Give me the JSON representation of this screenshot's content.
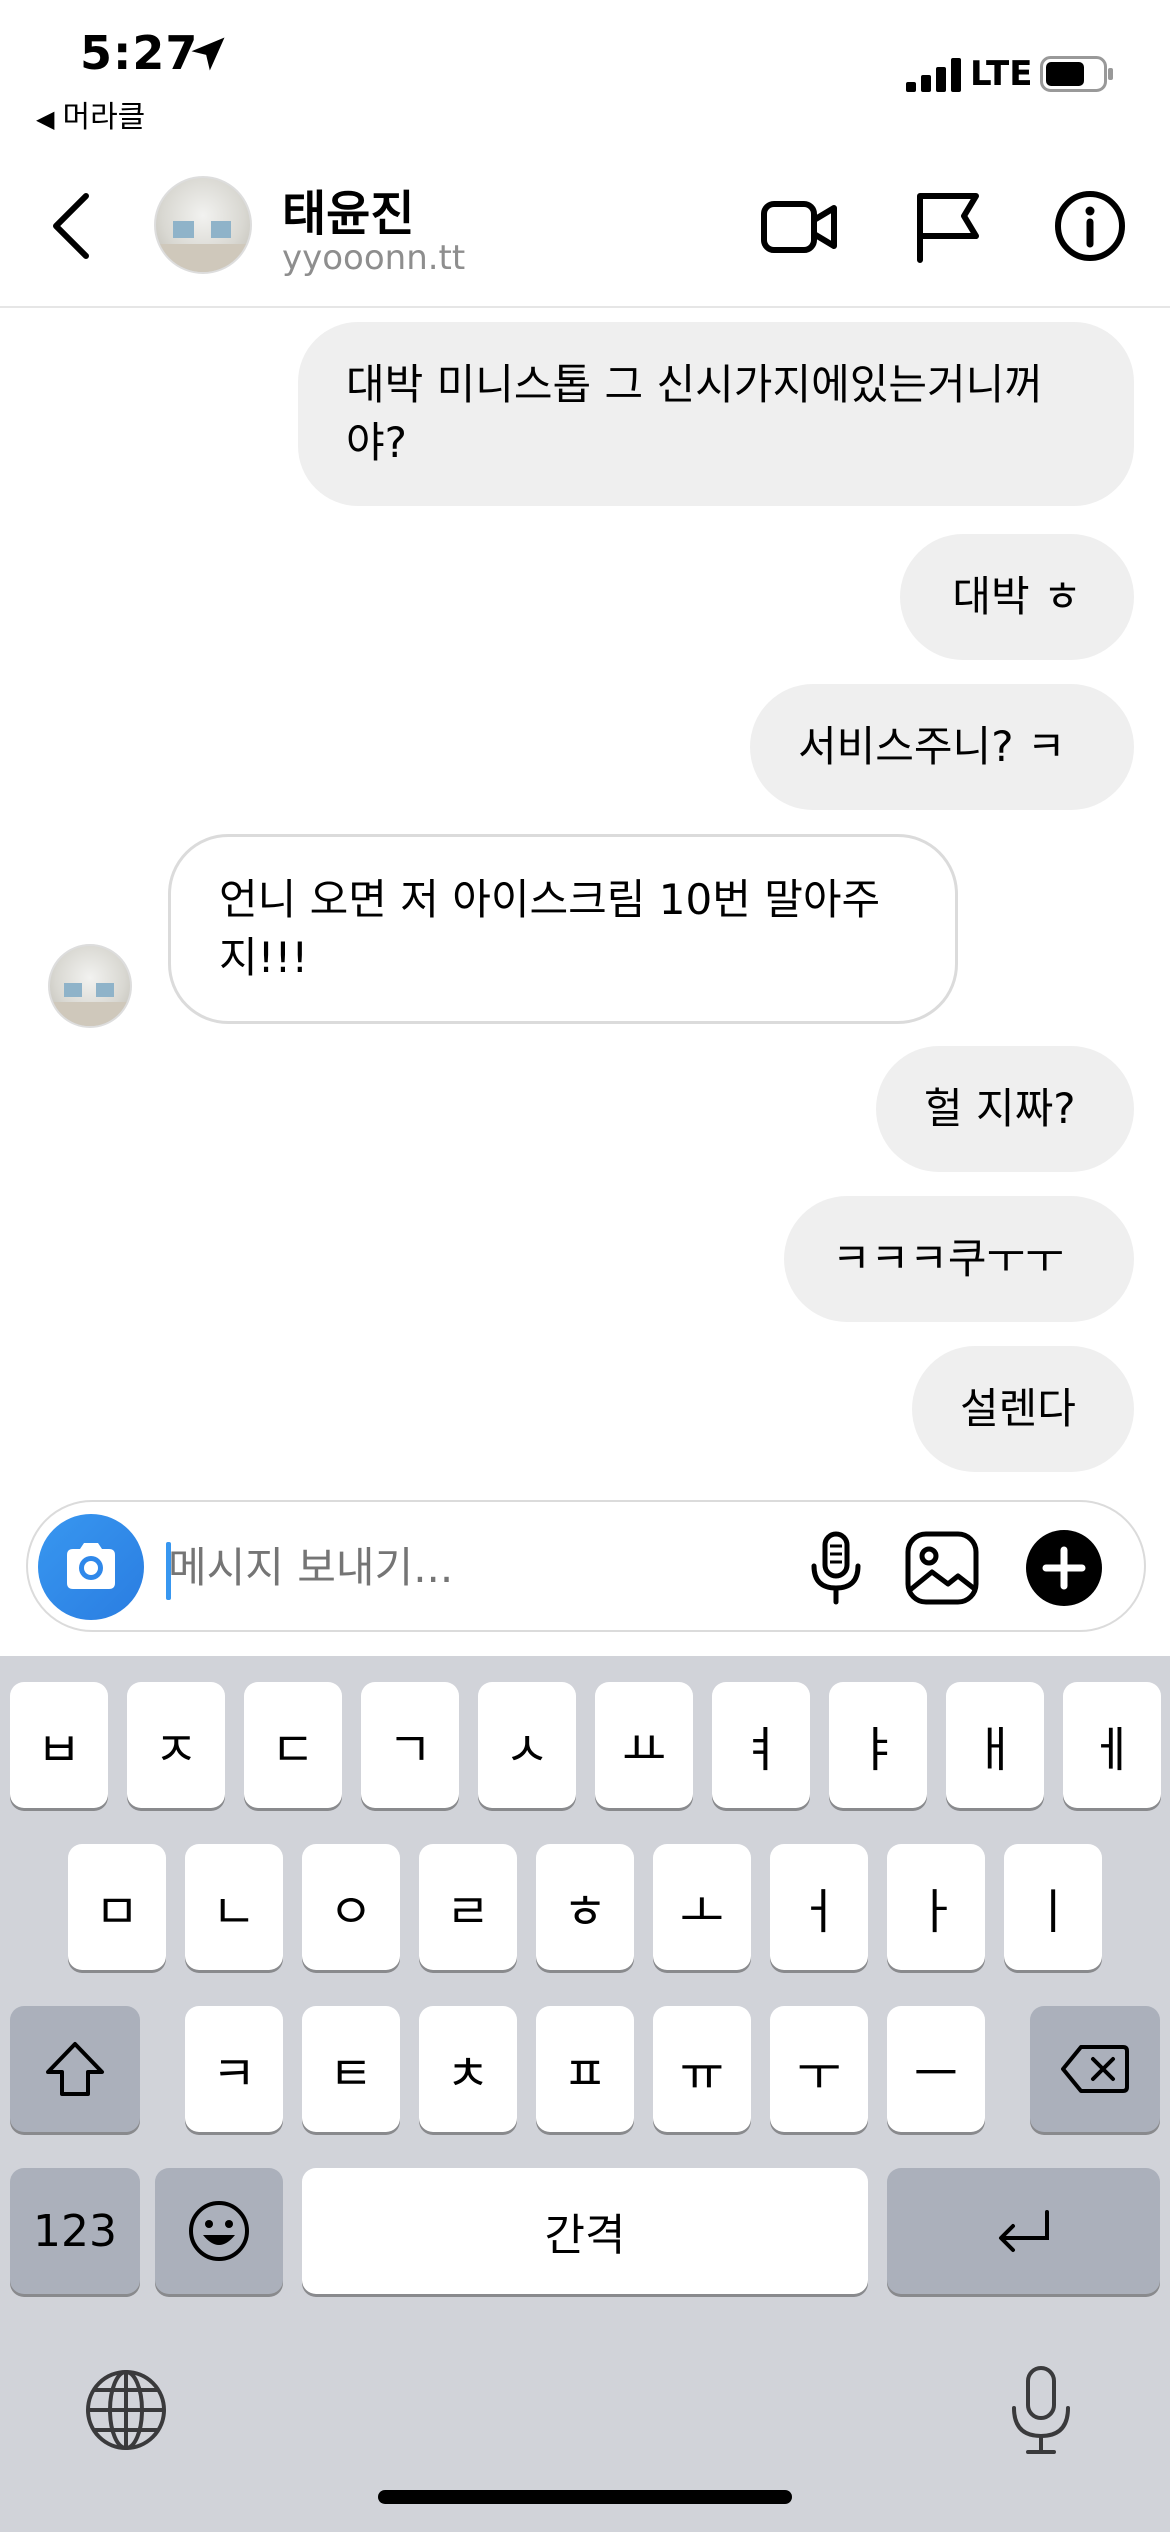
{
  "status_bar": {
    "time": "5:27",
    "back_app": "머라클",
    "network": "LTE"
  },
  "header": {
    "name": "태윤진",
    "username": "yyooonn.tt",
    "icons": [
      "back-icon",
      "video-call-icon",
      "flag-icon",
      "info-icon"
    ]
  },
  "messages": [
    {
      "direction": "sent",
      "text": "대박 미니스톱 그 신시가지에있는거니꺼\n야?"
    },
    {
      "direction": "sent",
      "text": "대박 ㅎ"
    },
    {
      "direction": "sent",
      "text": "서비스주니? ㅋ"
    },
    {
      "direction": "received",
      "text": "언니 오면 저 아이스크림 10번 말아주\n지!!!"
    },
    {
      "direction": "sent",
      "text": "헐 지짜?"
    },
    {
      "direction": "sent",
      "text": "ㅋㅋㅋ쿠ㅜㅜ"
    },
    {
      "direction": "sent",
      "text": "설렌다"
    }
  ],
  "composer": {
    "placeholder": "메시지 보내기...",
    "icons": [
      "camera-icon",
      "microphone-icon",
      "gallery-icon",
      "plus-icon"
    ]
  },
  "keyboard": {
    "row1": [
      "ㅂ",
      "ㅈ",
      "ㄷ",
      "ㄱ",
      "ㅅ",
      "ㅛ",
      "ㅕ",
      "ㅑ",
      "ㅐ",
      "ㅔ"
    ],
    "row2": [
      "ㅁ",
      "ㄴ",
      "ㅇ",
      "ㄹ",
      "ㅎ",
      "ㅗ",
      "ㅓ",
      "ㅏ",
      "ㅣ"
    ],
    "row3": [
      "ㅋ",
      "ㅌ",
      "ㅊ",
      "ㅍ",
      "ㅠ",
      "ㅜ",
      "ㅡ"
    ],
    "numbers_label": "123",
    "space_label": "간격"
  }
}
